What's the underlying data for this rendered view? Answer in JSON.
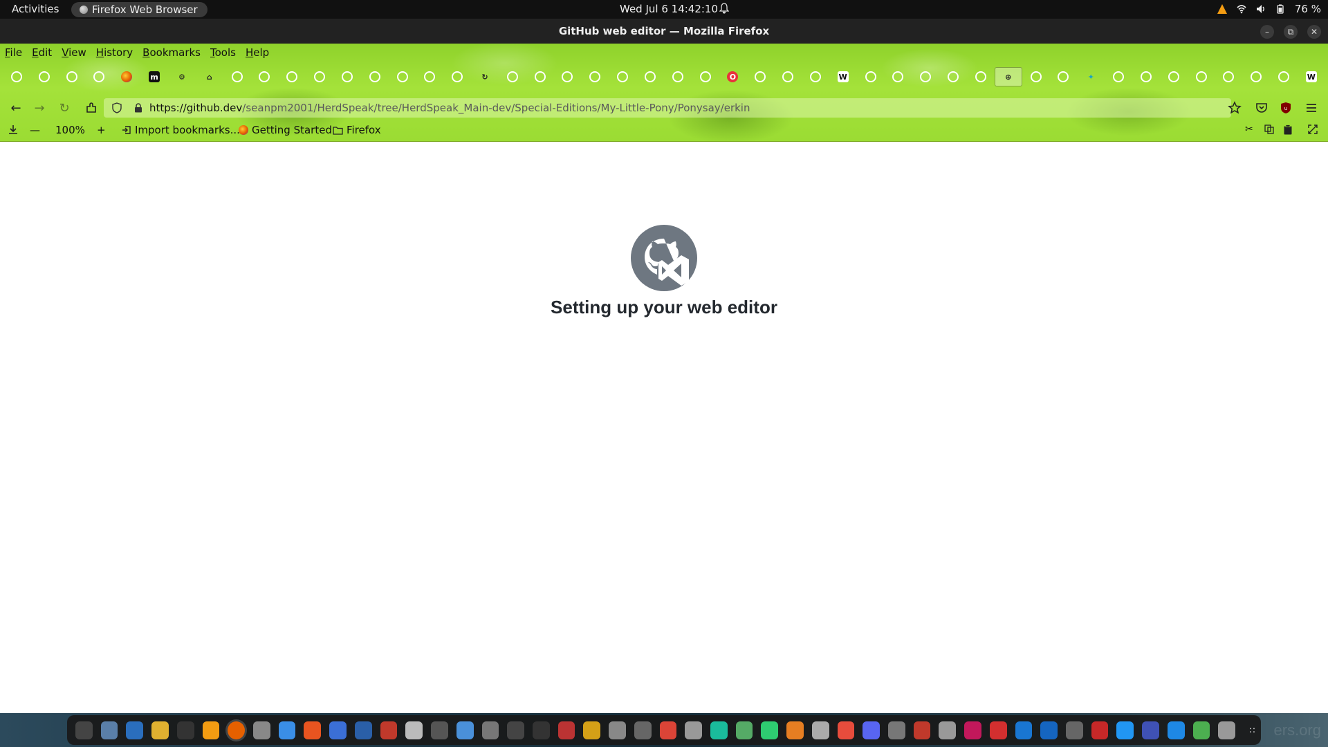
{
  "system_bar": {
    "activities": "Activities",
    "app_name": "Firefox Web Browser",
    "datetime": "Wed Jul 6  14:42:10",
    "battery": "76 %"
  },
  "window": {
    "title": "GitHub web editor — Mozilla Firefox",
    "controls": [
      "minimize-icon",
      "restore-icon",
      "close-icon"
    ]
  },
  "menubar": {
    "items": [
      {
        "label": "File",
        "key": "F",
        "rest": "ile"
      },
      {
        "label": "Edit",
        "key": "E",
        "rest": "dit"
      },
      {
        "label": "View",
        "key": "V",
        "rest": "iew"
      },
      {
        "label": "History",
        "key": "H",
        "rest": "istory"
      },
      {
        "label": "Bookmarks",
        "key": "B",
        "rest": "ookmarks"
      },
      {
        "label": "Tools",
        "key": "T",
        "rest": "ools"
      },
      {
        "label": "Help",
        "key": "H",
        "rest": "elp"
      }
    ]
  },
  "tabs": {
    "favicons": [
      "github",
      "github",
      "github",
      "github",
      "firefox",
      "mastodon",
      "settings",
      "puzzle",
      "github",
      "github",
      "github",
      "github",
      "github",
      "github",
      "github",
      "github",
      "github",
      "refresh",
      "github",
      "github",
      "github",
      "github",
      "github",
      "github",
      "github",
      "github",
      "opera",
      "github",
      "github",
      "github",
      "wikipedia",
      "github",
      "github",
      "github",
      "github",
      "github",
      "globe",
      "github",
      "github",
      "extension",
      "github",
      "github",
      "github",
      "github",
      "github",
      "github",
      "github",
      "wikipedia"
    ],
    "active_index": 36
  },
  "navbar": {
    "url_domain": "https://github.dev",
    "url_path": "/seanpm2001/HerdSpeak/tree/HerdSpeak_Main-dev/Special-Editions/My-Little-Pony/Ponysay/erkin",
    "icons": [
      "back-icon",
      "forward-icon",
      "reload-icon",
      "extensions-icon",
      "shield-icon",
      "lock-icon",
      "star-icon",
      "pocket-icon",
      "ublock-icon",
      "hamburger-menu-icon"
    ]
  },
  "bookmarks_bar": {
    "zoom": "100%",
    "zoom_out": "—",
    "zoom_in": "+",
    "items": [
      "Import bookmarks...",
      "Getting Started",
      "Firefox"
    ]
  },
  "content": {
    "loading_title": "Setting up your web editor"
  },
  "colors": {
    "accent_green": "#9bdc33",
    "text_dark": "#24292f",
    "logo_gray": "#6e7781"
  },
  "dock": {
    "watermark": "ers.org"
  }
}
